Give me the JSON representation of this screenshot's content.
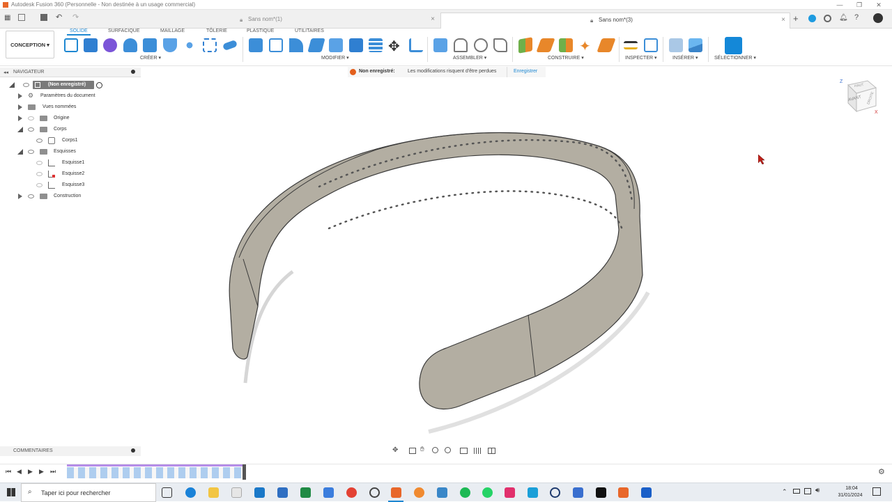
{
  "window": {
    "title": "Autodesk Fusion 360 (Personnelle - Non destinée à un usage commercial)",
    "minimize": "—",
    "restore": "❐",
    "close": "✕"
  },
  "tabs": [
    {
      "label": "Sans nom*(1)",
      "active": false
    },
    {
      "label": "Sans nom*(3)",
      "active": true
    }
  ],
  "ribbon": {
    "workspace": "CONCEPTION ▾",
    "tabs": [
      "SOLIDE",
      "SURFACIQUE",
      "MAILLAGE",
      "TÔLERIE",
      "PLASTIQUE",
      "UTILITAIRES"
    ],
    "groups": {
      "create": "CRÉER ▾",
      "modify": "MODIFIER ▾",
      "assemble": "ASSEMBLER ▾",
      "construct": "CONSTRUIRE ▾",
      "inspect": "INSPECTER ▾",
      "insert": "INSÉRER ▾",
      "select": "SÉLECTIONNER ▾"
    }
  },
  "warning": {
    "bold": "Non enregistré:",
    "message": "Les modifications risquent d'être perdues",
    "action": "Enregistrer"
  },
  "navigator": {
    "title": "NAVIGATEUR",
    "root": "(Non enregistré)",
    "items": [
      {
        "label": "Paramètres du document"
      },
      {
        "label": "Vues nommées"
      },
      {
        "label": "Origine"
      },
      {
        "label": "Corps"
      },
      {
        "label": "Corps1"
      },
      {
        "label": "Esquisses"
      },
      {
        "label": "Esquisse1"
      },
      {
        "label": "Esquisse2"
      },
      {
        "label": "Esquisse3"
      },
      {
        "label": "Construction"
      }
    ]
  },
  "viewcube": {
    "top": "HAUT",
    "front": "AVANT",
    "right": "DROITE",
    "z": "Z",
    "x": "X"
  },
  "comments": {
    "title": "COMMENTAIRES"
  },
  "taskbar": {
    "search_placeholder": "Taper ici pour rechercher",
    "time": "18:04",
    "date": "31/01/2024"
  },
  "colors": {
    "accent": "#1e88d2",
    "body": "#b3aea2",
    "edge": "#3a3a3a",
    "autodesk_orange": "#e8672a",
    "warning": "#e35f1c"
  }
}
